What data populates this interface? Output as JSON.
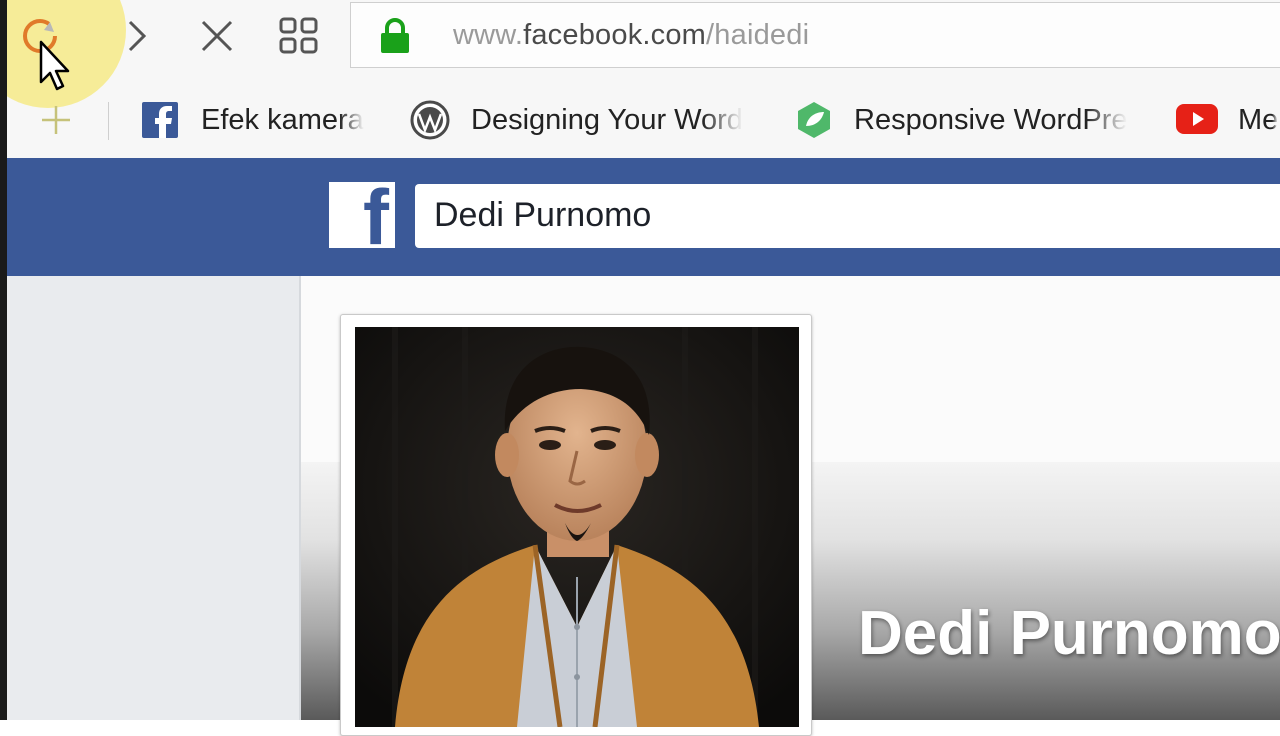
{
  "browser": {
    "url_prefix": "www.",
    "url_domain": "facebook.com",
    "url_path": "/haidedi",
    "bookmarks": [
      {
        "label": "Efek kamera",
        "icon": "facebook-icon"
      },
      {
        "label": "Designing Your Word",
        "icon": "wordpress-icon"
      },
      {
        "label": "Responsive WordPre",
        "icon": "leaf-icon"
      },
      {
        "label": "Me",
        "icon": "youtube-icon"
      }
    ],
    "colors": {
      "lock": "#1aa11a",
      "highlight": "#f6e878"
    }
  },
  "facebook": {
    "logo": "f",
    "search_value": "Dedi Purnomo",
    "brand_color": "#3b5998"
  },
  "profile": {
    "cover_name": "Dedi Purnomo"
  }
}
